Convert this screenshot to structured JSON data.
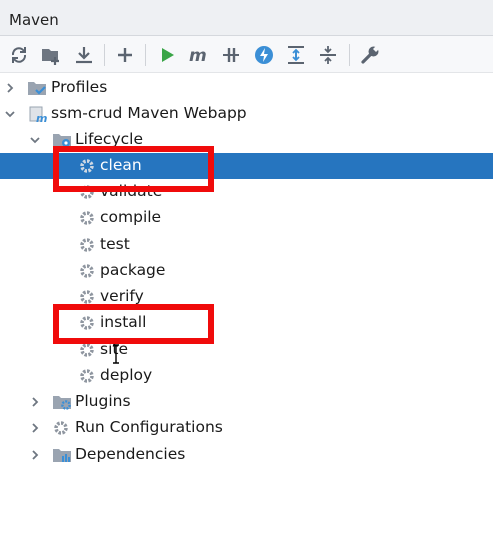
{
  "window": {
    "title": "Maven"
  },
  "toolbar": {
    "icons": [
      "reload-icon",
      "folder-add-icon",
      "download-icon",
      "plus-icon",
      "run-icon",
      "execute-goal-icon",
      "toggle-offline-icon",
      "lightning-icon",
      "expand-all-icon",
      "collapse-all-icon",
      "wrench-icon"
    ]
  },
  "tree": {
    "profiles": "Profiles",
    "project": "ssm-crud Maven Webapp",
    "lifecycle": "Lifecycle",
    "goals": [
      "clean",
      "validate",
      "compile",
      "test",
      "package",
      "verify",
      "install",
      "site",
      "deploy"
    ],
    "plugins": "Plugins",
    "run_configurations": "Run Configurations",
    "dependencies": "Dependencies"
  },
  "selection": "clean",
  "annotations": {
    "highlight_color": "#f00b0b",
    "highlighted": [
      "clean",
      "install"
    ]
  },
  "colors": {
    "selected_row": "#2675bf",
    "run_green": "#3aa547",
    "gear_gray": "#8f96a0",
    "folder_gray": "#9aa4b1",
    "accent_blue": "#3b8fd6"
  }
}
